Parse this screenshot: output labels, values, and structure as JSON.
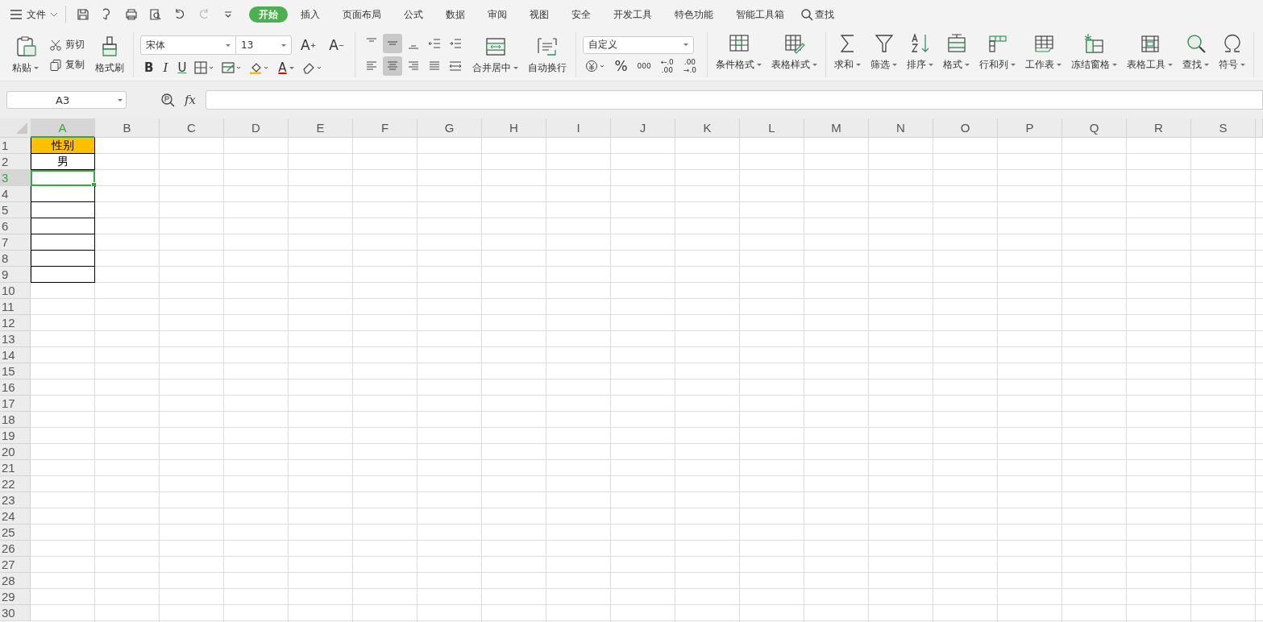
{
  "file_menu": {
    "label": "文件"
  },
  "menu_tabs": [
    {
      "label": "开始",
      "selected": true
    },
    {
      "label": "插入",
      "selected": false
    },
    {
      "label": "页面布局",
      "selected": false
    },
    {
      "label": "公式",
      "selected": false
    },
    {
      "label": "数据",
      "selected": false
    },
    {
      "label": "审阅",
      "selected": false
    },
    {
      "label": "视图",
      "selected": false
    },
    {
      "label": "安全",
      "selected": false
    },
    {
      "label": "开发工具",
      "selected": false
    },
    {
      "label": "特色功能",
      "selected": false
    },
    {
      "label": "智能工具箱",
      "selected": false
    }
  ],
  "search": {
    "label": "查找"
  },
  "clipboard": {
    "paste": "粘贴",
    "cut": "剪切",
    "copy": "复制",
    "format_painter": "格式刷"
  },
  "font": {
    "name": "宋体",
    "size": "13",
    "grow": "A",
    "grow_mark": "+",
    "shrink": "A",
    "shrink_mark": "−",
    "bold": "B",
    "italic": "I",
    "underline": "U",
    "font_color": "A"
  },
  "alignment": {
    "vertical": [
      {
        "selected": false
      },
      {
        "selected": true
      },
      {
        "selected": false
      }
    ],
    "horizontal": [
      {
        "selected": false
      },
      {
        "selected": true
      },
      {
        "selected": false
      },
      {
        "selected": false
      }
    ],
    "merge": "合并居中",
    "wrap": "自动换行"
  },
  "number": {
    "format": "自定义",
    "percent": "%",
    "thousands": "000",
    "increase_decimal": {
      "top": "←.0",
      "bottom": ".00"
    },
    "decrease_decimal": {
      "top": ".00",
      "bottom": "→.0"
    }
  },
  "tools": [
    {
      "label": "条件格式"
    },
    {
      "label": "表格样式"
    },
    {
      "label": "求和"
    },
    {
      "label": "筛选"
    },
    {
      "label": "排序"
    },
    {
      "label": "格式"
    },
    {
      "label": "行和列"
    },
    {
      "label": "工作表"
    },
    {
      "label": "冻结窗格"
    },
    {
      "label": "表格工具"
    },
    {
      "label": "查找"
    },
    {
      "label": "符号"
    }
  ],
  "formula_bar": {
    "cell_ref": "A3",
    "fx": "fx"
  },
  "sheet": {
    "columns": [
      {
        "label": "A",
        "selected": true
      },
      {
        "label": "B",
        "selected": false
      },
      {
        "label": "C",
        "selected": false
      },
      {
        "label": "D",
        "selected": false
      },
      {
        "label": "E",
        "selected": false
      },
      {
        "label": "F",
        "selected": false
      },
      {
        "label": "G",
        "selected": false
      },
      {
        "label": "H",
        "selected": false
      },
      {
        "label": "I",
        "selected": false
      },
      {
        "label": "J",
        "selected": false
      },
      {
        "label": "K",
        "selected": false
      },
      {
        "label": "L",
        "selected": false
      },
      {
        "label": "M",
        "selected": false
      },
      {
        "label": "N",
        "selected": false
      },
      {
        "label": "O",
        "selected": false
      },
      {
        "label": "P",
        "selected": false
      },
      {
        "label": "Q",
        "selected": false
      },
      {
        "label": "R",
        "selected": false
      },
      {
        "label": "S",
        "selected": false
      }
    ],
    "rows": [
      {
        "label": "1",
        "selected": false,
        "cell_a": {
          "text": "性别",
          "color": "#ffc000",
          "bordered": true,
          "selected": false
        }
      },
      {
        "label": "2",
        "selected": false,
        "cell_a": {
          "text": "男",
          "bordered": true,
          "selected": false
        }
      },
      {
        "label": "3",
        "selected": true,
        "cell_a": {
          "bordered": true,
          "selected": true
        }
      },
      {
        "label": "4",
        "selected": false,
        "cell_a": {
          "bordered": true,
          "selected": false
        }
      },
      {
        "label": "5",
        "selected": false,
        "cell_a": {
          "bordered": true,
          "selected": false
        }
      },
      {
        "label": "6",
        "selected": false,
        "cell_a": {
          "bordered": true,
          "selected": false
        }
      },
      {
        "label": "7",
        "selected": false,
        "cell_a": {
          "bordered": true,
          "selected": false
        }
      },
      {
        "label": "8",
        "selected": false,
        "cell_a": {
          "bordered": true,
          "selected": false
        }
      },
      {
        "label": "9",
        "selected": false,
        "cell_a": {
          "bordered": true,
          "selected": false
        }
      },
      {
        "label": "10",
        "selected": false
      },
      {
        "label": "11",
        "selected": false
      },
      {
        "label": "12",
        "selected": false
      },
      {
        "label": "13",
        "selected": false
      },
      {
        "label": "14",
        "selected": false
      },
      {
        "label": "15",
        "selected": false
      },
      {
        "label": "16",
        "selected": false
      },
      {
        "label": "17",
        "selected": false
      },
      {
        "label": "18",
        "selected": false
      },
      {
        "label": "19",
        "selected": false
      },
      {
        "label": "20",
        "selected": false
      },
      {
        "label": "21",
        "selected": false
      },
      {
        "label": "22",
        "selected": false
      },
      {
        "label": "23",
        "selected": false
      },
      {
        "label": "24",
        "selected": false
      },
      {
        "label": "25",
        "selected": false
      },
      {
        "label": "26",
        "selected": false
      },
      {
        "label": "27",
        "selected": false
      },
      {
        "label": "28",
        "selected": false
      },
      {
        "label": "29",
        "selected": false
      },
      {
        "label": "30",
        "selected": false
      }
    ]
  }
}
